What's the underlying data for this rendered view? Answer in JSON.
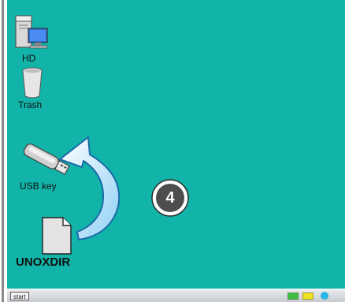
{
  "desktop": {
    "background_color": "#12b4a9",
    "icons": [
      {
        "label": "HD",
        "icon": "computer-icon"
      },
      {
        "label": "Trash",
        "icon": "trash-icon"
      },
      {
        "label": "USB key",
        "icon": "usb-key-icon"
      },
      {
        "label": "UNOXDIR",
        "icon": "document-icon"
      }
    ],
    "step_badge": "4",
    "arrow": "curved-arrow-icon"
  },
  "taskbar": {
    "start_label": "start",
    "tray": [
      "green-indicator",
      "yellow-indicator",
      "blue-dot-indicator"
    ]
  }
}
